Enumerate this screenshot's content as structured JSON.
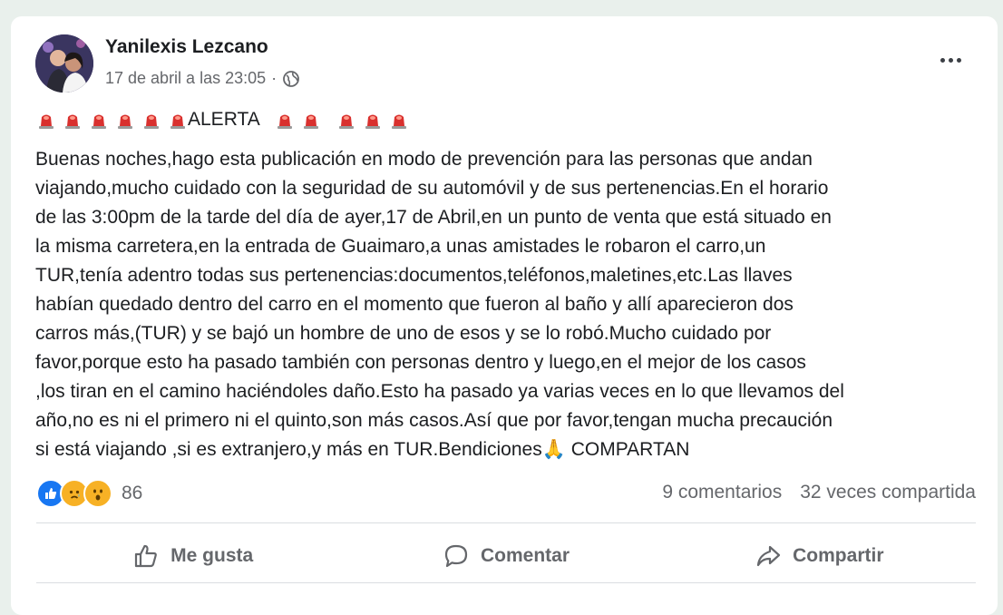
{
  "post": {
    "author": "Yanilexis Lezcano",
    "timestamp": "17 de abril a las 23:05",
    "separator": "·",
    "audience_icon": "globe-icon",
    "alert_word": "ALERTA",
    "alert_icon": "police-siren-emoji",
    "body": "Buenas noches,hago esta publicación en modo de prevención para las personas que andan\nviajando,mucho cuidado con la seguridad de su automóvil y de sus pertenencias.En el horario\nde las 3:00pm de la tarde del día de ayer,17 de Abril,en un punto de venta que está situado en\nla misma carretera,en la entrada de Guaimaro,a unas amistades le robaron el carro,un\nTUR,tenía adentro todas sus pertenencias:documentos,teléfonos,maletines,etc.Las llaves\nhabían quedado dentro del carro en el momento que fueron al baño y allí aparecieron dos\ncarros más,(TUR) y se bajó un hombre de uno de esos y se lo robó.Mucho cuidado por\nfavor,porque esto ha pasado también con personas dentro y luego,en el mejor de los casos\n,los tiran en el camino haciéndoles daño.Esto ha pasado ya varias veces en lo que llevamos del\naño,no es ni el primero ni el quinto,son más casos.Así que por favor,tengan mucha precaución\nsi está viajando ,si es extranjero,y más en TUR.Bendiciones",
    "body_end_emoji": "🙏",
    "body_end": " COMPARTAN"
  },
  "reactions": {
    "count": "86",
    "types": [
      "like-icon",
      "sad-icon",
      "wow-icon"
    ],
    "comments": "9 comentarios",
    "shares": "32 veces compartida"
  },
  "actions": {
    "like": "Me gusta",
    "comment": "Comentar",
    "share": "Compartir"
  },
  "colors": {
    "like_blue": "#1877f2",
    "reaction_yellow": "#f7b125",
    "siren_red": "#d9302e",
    "muted_text": "#65676b"
  }
}
